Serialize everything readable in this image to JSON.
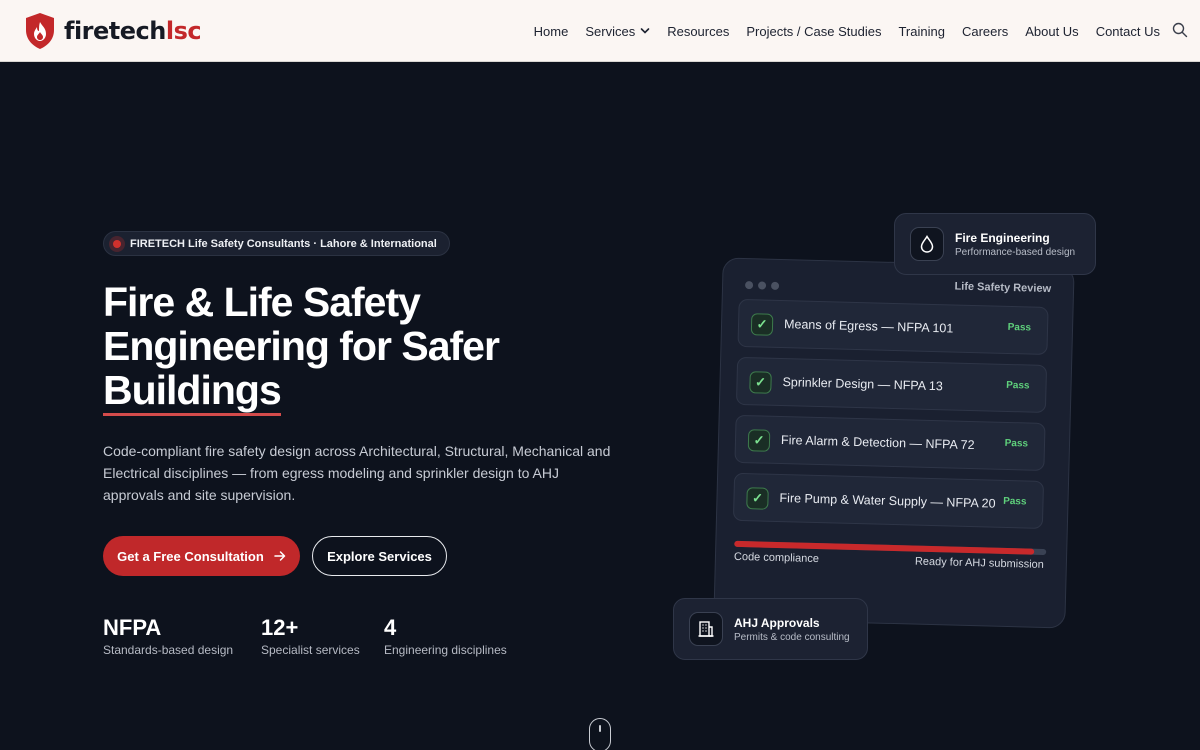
{
  "brand": {
    "name_main": "firetech",
    "name_accent": "lsc",
    "color_accent": "#c3282a",
    "icon": "shield-flame-icon"
  },
  "nav": {
    "items": [
      {
        "label": "Home"
      },
      {
        "label": "Services",
        "has_dropdown": true
      },
      {
        "label": "Resources"
      },
      {
        "label": "Projects / Case Studies"
      },
      {
        "label": "Training"
      },
      {
        "label": "Careers"
      },
      {
        "label": "About Us"
      },
      {
        "label": "Contact Us"
      }
    ],
    "search_icon": "search-icon"
  },
  "hero": {
    "badge": "FIRETECH Life Safety Consultants · Lahore & International",
    "title_line1": "Fire & Life Safety",
    "title_line2": "Engineering for Safer",
    "title_line3": "Buildings",
    "description": "Code-compliant fire safety design across Architectural, Structural, Mechanical and Electrical disciplines — from egress modeling and sprinkler design to AHJ approvals and site supervision.",
    "cta_primary": "Get a Free Consultation",
    "cta_secondary": "Explore Services",
    "stats": [
      {
        "value": "NFPA",
        "label": "Standards-based design"
      },
      {
        "value": "12+",
        "label": "Specialist services"
      },
      {
        "value": "4",
        "label": "Engineering disciplines"
      }
    ]
  },
  "review": {
    "title": "Life Safety Review",
    "items": [
      {
        "label": "Means of Egress — NFPA 101",
        "status": "Pass"
      },
      {
        "label": "Sprinkler Design — NFPA 13",
        "status": "Pass"
      },
      {
        "label": "Fire Alarm & Detection — NFPA 72",
        "status": "Pass"
      },
      {
        "label": "Fire Pump & Water Supply — NFPA 20",
        "status": "Pass"
      }
    ],
    "progress_label": "Code compliance",
    "progress_status": "Ready for AHJ submission",
    "progress_fraction": 0.96
  },
  "float_cards": {
    "engineering": {
      "title": "Fire Engineering",
      "subtitle": "Performance-based design",
      "icon": "droplet-icon"
    },
    "approvals": {
      "title": "AHJ Approvals",
      "subtitle": "Permits & code consulting",
      "icon": "building-icon"
    }
  }
}
